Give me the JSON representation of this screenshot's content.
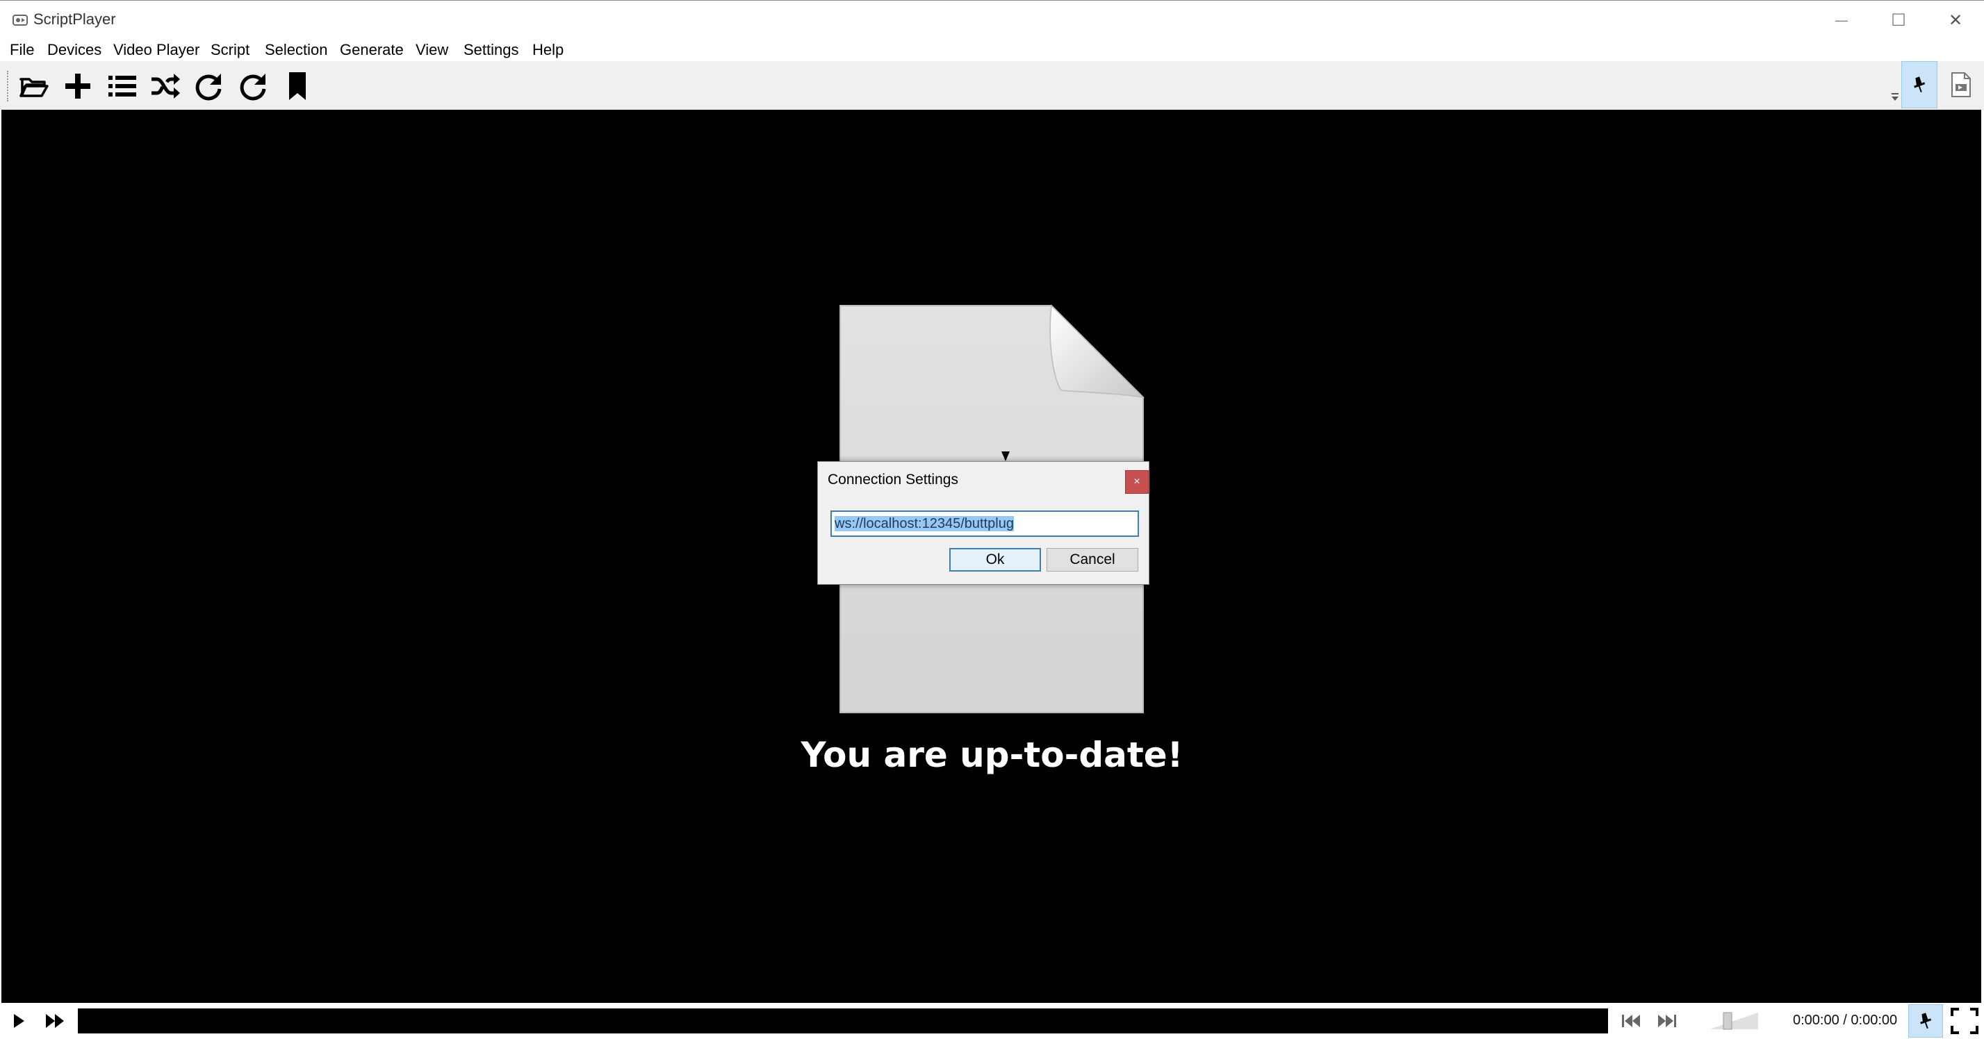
{
  "window": {
    "title": "ScriptPlayer",
    "minimize_glyph": "—",
    "maximize_glyph": "☐",
    "close_glyph": "✕"
  },
  "menu": [
    "File",
    "Devices",
    "Video Player",
    "Script",
    "Selection",
    "Generate",
    "View",
    "Settings",
    "Help"
  ],
  "toolbar": {
    "icons": [
      "open-folder-icon",
      "add-icon",
      "playlist-icon",
      "shuffle-icon",
      "repeat-icon",
      "redo-icon",
      "bookmark-icon"
    ],
    "right_icons": [
      "pin-icon",
      "script-file-icon"
    ]
  },
  "video": {
    "message": "You are up-to-date!"
  },
  "dialog": {
    "title": "Connection Settings",
    "close_glyph": "×",
    "url_value": "ws://localhost:12345/buttplug",
    "ok_label": "Ok",
    "cancel_label": "Cancel"
  },
  "controls": {
    "time": "0:00:00 / 0:00:00",
    "volume_level": 0.35,
    "seek_progress": 0
  },
  "colors": {
    "accent": "#3c7fb1",
    "selection": "#99c9ef",
    "active_button": "#cce4f7",
    "close_button": "#c75050",
    "video_bg": "#000000"
  }
}
